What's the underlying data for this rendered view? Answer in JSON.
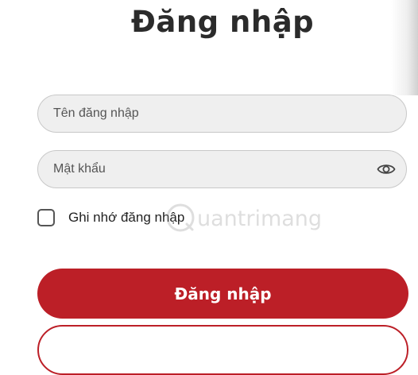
{
  "page": {
    "title": "Đăng nhập"
  },
  "form": {
    "username": {
      "placeholder": "Tên đăng nhập",
      "value": ""
    },
    "password": {
      "placeholder": "Mật khẩu",
      "value": "",
      "toggle_icon": "eye-icon"
    },
    "remember": {
      "label": "Ghi nhớ đăng nhập",
      "checked": false
    },
    "submit_label": "Đăng nhập"
  },
  "watermark": {
    "text": "uantrimang"
  },
  "colors": {
    "accent": "#bc1f27",
    "title": "#2b2b2b",
    "field_bg": "#efefef",
    "field_border": "#c8c8c8"
  }
}
